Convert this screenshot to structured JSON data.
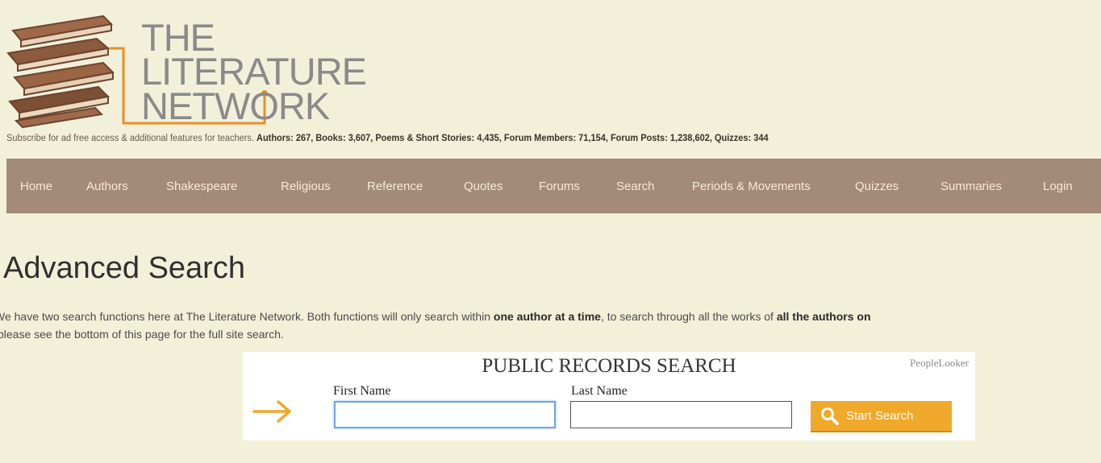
{
  "logo": {
    "line1": "THE",
    "line2": "LITERATURE",
    "line3": "NETWORK"
  },
  "tagline": {
    "subscribe": "Subscribe for ad free access & additional features for teachers.",
    "stats": "Authors: 267, Books: 3,607, Poems & Short Stories: 4,435, Forum Members: 71,154, Forum Posts: 1,238,602, Quizzes: 344"
  },
  "nav": [
    "Home",
    "Authors",
    "Shakespeare",
    "Religious",
    "Reference",
    "Quotes",
    "Forums",
    "Search",
    "Periods & Movements",
    "Quizzes",
    "Summaries",
    "Login"
  ],
  "page": {
    "title": "Advanced Search",
    "intro_1": "We have two search functions here at The Literature Network. Both functions will only search within ",
    "intro_bold_1": "one author at a time",
    "intro_2": ", to search through all the works of ",
    "intro_bold_2": "all the authors on",
    "intro_3": "please see the bottom of this page for the full site search."
  },
  "ad": {
    "title": "PUBLIC RECORDS SEARCH",
    "brand": "PeopleLooker",
    "first_name_label": "First Name",
    "last_name_label": "Last Name",
    "first_name_value": "",
    "last_name_value": "",
    "button_label": "Start Search"
  },
  "colors": {
    "background": "#f3f0da",
    "nav": "#a48b77",
    "button": "#f0a92a",
    "logo_line": "#e8902a"
  }
}
